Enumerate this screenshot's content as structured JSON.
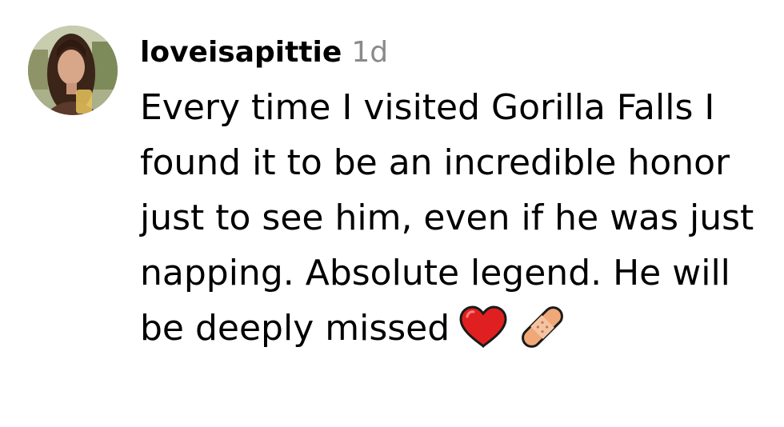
{
  "comment": {
    "username": "loveisapittie",
    "timestamp": "1d",
    "text": "Every time I visited Gorilla Falls I found it to be an incredible honor just to see him, even if he was just napping. Absolute legend. He will be deeply missed",
    "emojis": [
      "red-heart-emoji",
      "bandage-emoji"
    ]
  }
}
